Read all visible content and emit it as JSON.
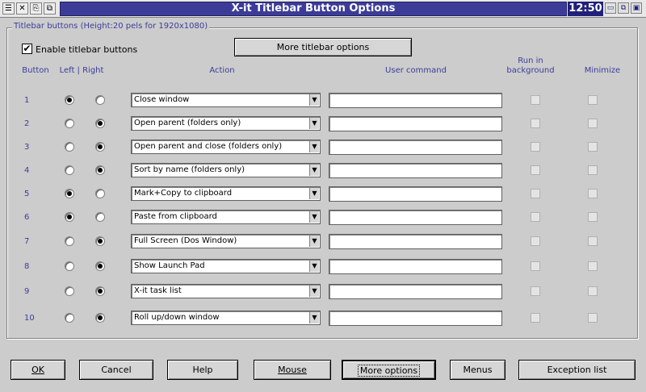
{
  "window": {
    "title": "X-it Titlebar Button Options",
    "clock": "12:50",
    "left_icons": [
      "☰",
      "✕",
      "⎘",
      "⧉"
    ],
    "right_icons": [
      "▭",
      "⧉",
      "▣"
    ]
  },
  "group": {
    "legend": "Titlebar buttons  (Height:20 pels for 1920x1080)",
    "enable_label": "Enable titlebar buttons",
    "enable_checked": "✔",
    "more_titlebar_label": "More titlebar options"
  },
  "headers": {
    "button": "Button",
    "left_right": "Left | Right",
    "action": "Action",
    "user_command": "User command",
    "run_bg_1": "Run in",
    "run_bg_2": "background",
    "minimize": "Minimize"
  },
  "rows": [
    {
      "num": "1",
      "side": "left",
      "action": "Close window",
      "command": ""
    },
    {
      "num": "2",
      "side": "right",
      "action": "Open parent (folders only)",
      "command": ""
    },
    {
      "num": "3",
      "side": "right",
      "action": "Open parent and close (folders only)",
      "command": ""
    },
    {
      "num": "4",
      "side": "right",
      "action": "Sort by name (folders only)",
      "command": ""
    },
    {
      "num": "5",
      "side": "left",
      "action": "Mark+Copy to clipboard",
      "command": ""
    },
    {
      "num": "6",
      "side": "left",
      "action": "Paste from clipboard",
      "command": ""
    },
    {
      "num": "7",
      "side": "right",
      "action": "Full Screen (Dos Window)",
      "command": ""
    },
    {
      "num": "8",
      "side": "right",
      "action": "Show Launch Pad",
      "command": ""
    },
    {
      "num": "9",
      "side": "right",
      "action": "X-it task list",
      "command": ""
    },
    {
      "num": "10",
      "side": "right",
      "action": "Roll up/down window",
      "command": ""
    }
  ],
  "buttons": {
    "ok": "OK",
    "cancel": "Cancel",
    "help": "Help",
    "mouse": "Mouse",
    "more_options": "More options",
    "menus": "Menus",
    "exception_list": "Exception list"
  }
}
